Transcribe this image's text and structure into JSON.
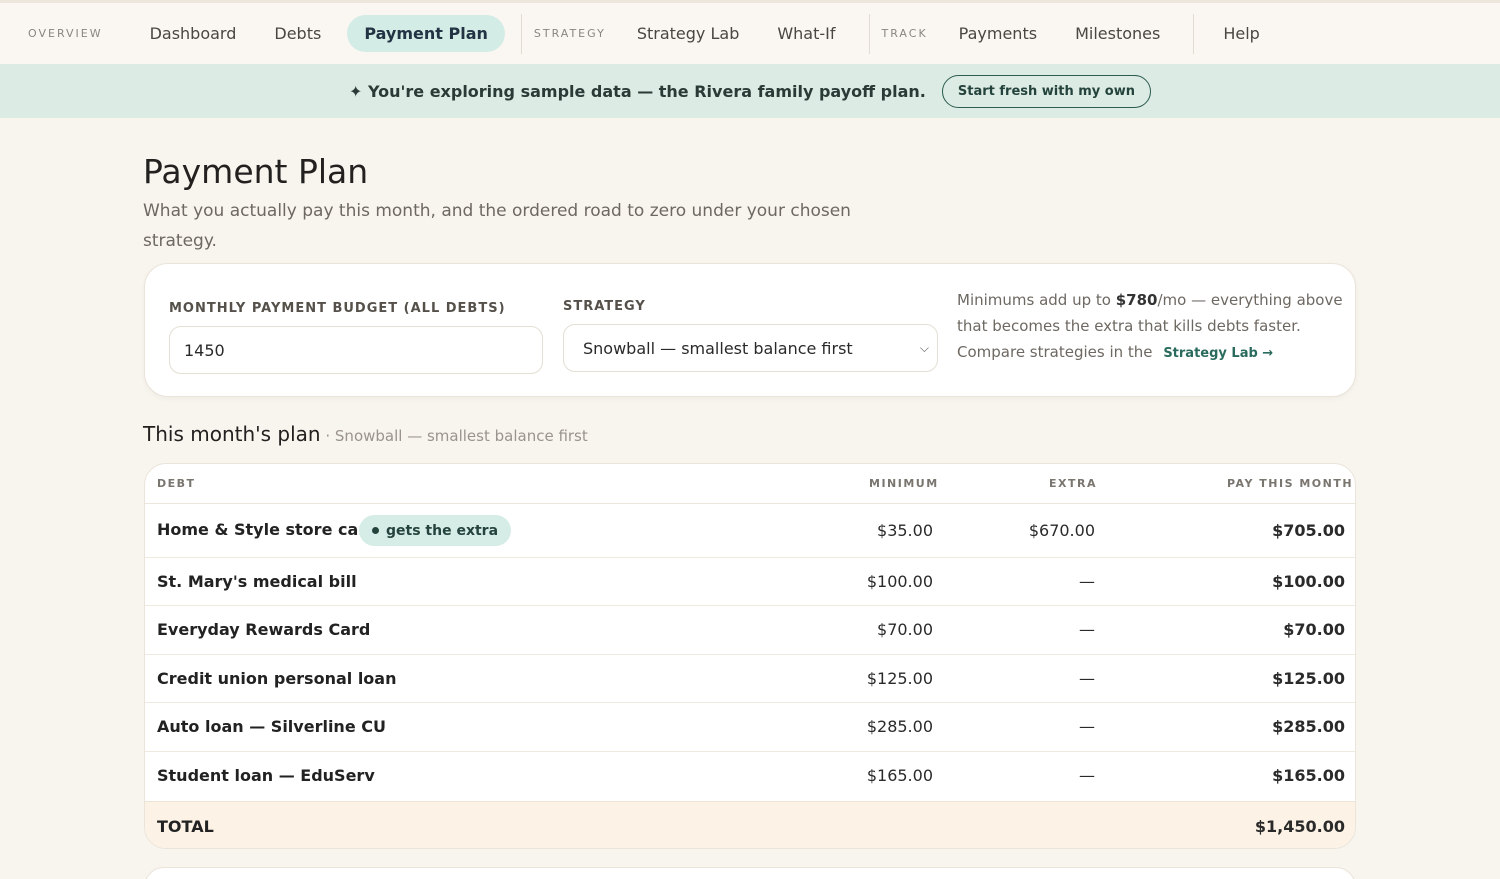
{
  "nav": {
    "groups": [
      "OVERVIEW",
      "STRATEGY",
      "TRACK"
    ],
    "items": [
      "Dashboard",
      "Debts",
      "Payment Plan",
      "Strategy Lab",
      "What-If",
      "Payments",
      "Milestones",
      "Help"
    ],
    "active": "Payment Plan"
  },
  "banner": {
    "text": "✦ You're exploring sample data — the Rivera family payoff plan.",
    "button": "Start fresh with my own"
  },
  "page": {
    "title": "Payment Plan",
    "subtitle": "What you actually pay this month, and the ordered road to zero under your chosen strategy."
  },
  "settings": {
    "budget_label": "MONTHLY PAYMENT BUDGET (ALL DEBTS)",
    "budget_value": "1450",
    "strategy_label": "STRATEGY",
    "strategy_value": "Snowball — smallest balance first",
    "hint_pre": "Minimums add up to ",
    "hint_amount": "$780",
    "hint_post": "/mo — everything above that becomes the extra that kills debts faster. Compare strategies in the ",
    "hint_link": "Strategy Lab →"
  },
  "plan": {
    "title": "This month's plan",
    "subtitle": " · Snowball — smallest balance first",
    "headers": [
      "DEBT",
      "MINIMUM",
      "EXTRA",
      "PAY THIS MONTH"
    ],
    "badge": "gets the extra",
    "rows": [
      {
        "name": "Home & Style store card",
        "min": "$35.00",
        "extra": "$670.00",
        "pay": "$705.00"
      },
      {
        "name": "St. Mary's medical bill",
        "min": "$100.00",
        "extra": "—",
        "pay": "$100.00"
      },
      {
        "name": "Everyday Rewards Card",
        "min": "$70.00",
        "extra": "—",
        "pay": "$70.00"
      },
      {
        "name": "Credit union personal loan",
        "min": "$125.00",
        "extra": "—",
        "pay": "$125.00"
      },
      {
        "name": "Auto loan — Silverline CU",
        "min": "$285.00",
        "extra": "—",
        "pay": "$285.00"
      },
      {
        "name": "Student loan — EduServ",
        "min": "$165.00",
        "extra": "—",
        "pay": "$165.00"
      }
    ],
    "total_label": "TOTAL",
    "total_value": "$1,450.00"
  }
}
